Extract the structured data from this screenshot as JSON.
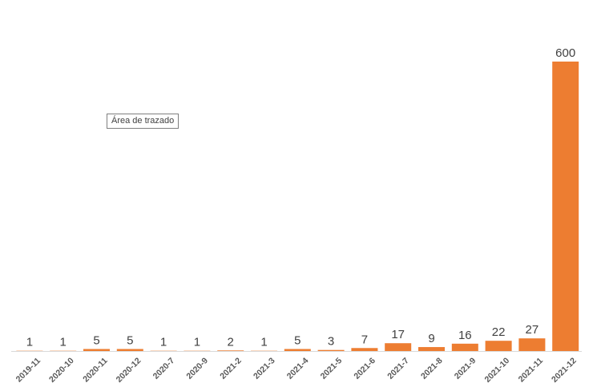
{
  "tooltip": {
    "text": "Área de trazado"
  },
  "colors": {
    "bar": "#ED7D31",
    "axis": "#D9D9D9",
    "label": "#404040",
    "tick": "#595959"
  },
  "chart_data": {
    "type": "bar",
    "title": "",
    "xlabel": "",
    "ylabel": "",
    "grid": false,
    "legend": "none",
    "categories": [
      "2019-11",
      "2020-10",
      "2020-11",
      "2020-12",
      "2020-7",
      "2020-9",
      "2021-2",
      "2021-3",
      "2021-4",
      "2021-5",
      "2021-6",
      "2021-7",
      "2021-8",
      "2021-9",
      "2021-10",
      "2021-11",
      "2021-12"
    ],
    "values": [
      1,
      1,
      5,
      5,
      1,
      1,
      2,
      1,
      5,
      3,
      7,
      17,
      9,
      16,
      22,
      27,
      600
    ],
    "ylim": [
      0,
      600
    ]
  }
}
